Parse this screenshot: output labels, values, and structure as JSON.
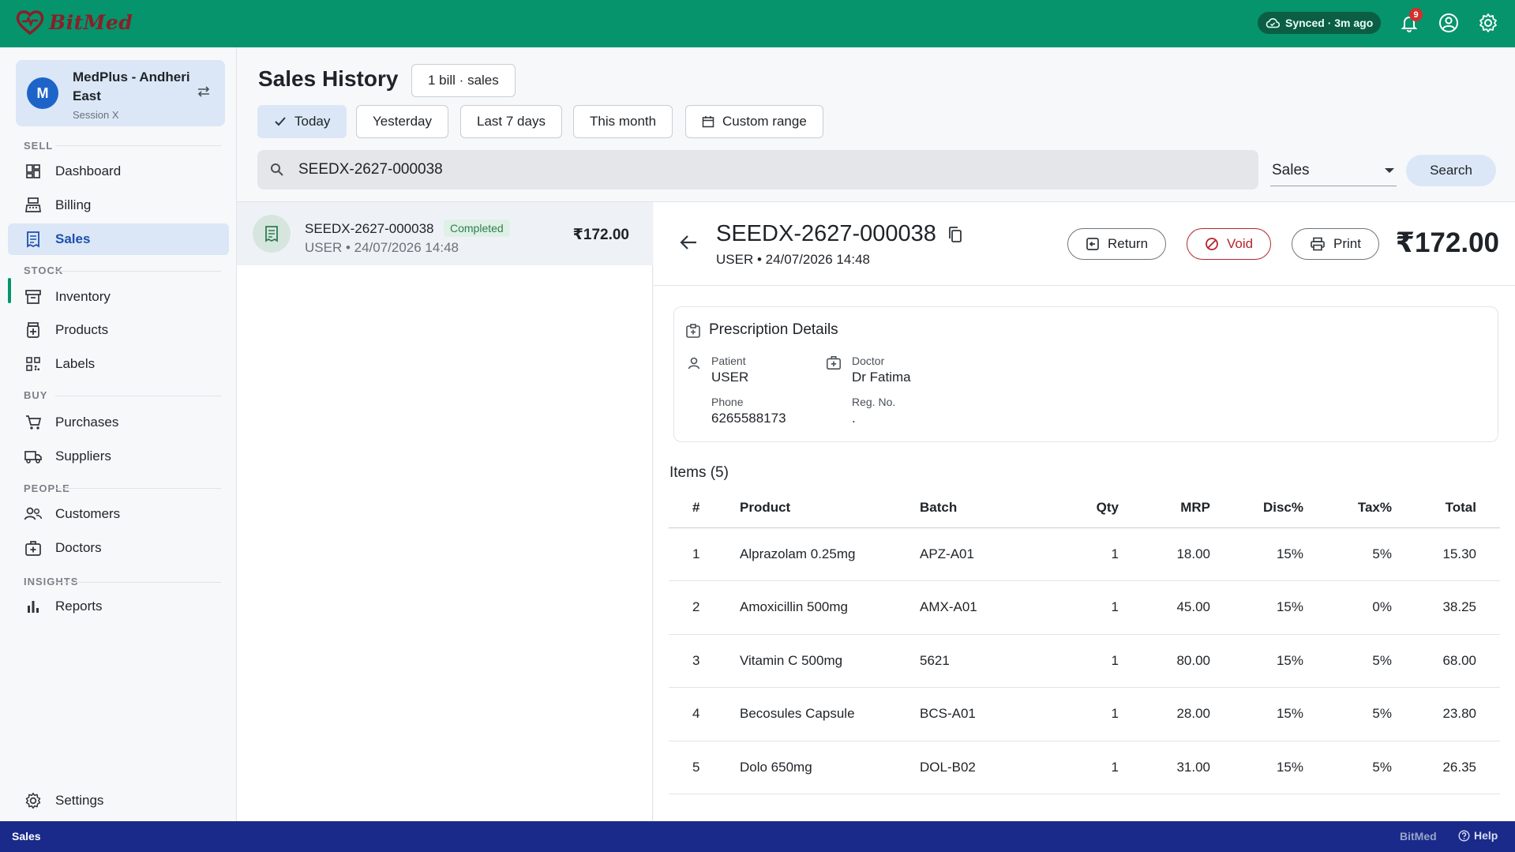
{
  "app": {
    "brand": "BitMed",
    "sync_status": "Synced · 3m ago",
    "notification_count": "9",
    "colors": {
      "topbar": "#05946c",
      "statusbar": "#1a2a8a",
      "accent": "#1d4fb0",
      "void": "#b3262e"
    }
  },
  "store": {
    "avatar_letter": "M",
    "name": "MedPlus - Andheri East",
    "session": "Session X"
  },
  "sidebar": {
    "sections": {
      "sell": "SELL",
      "stock": "STOCK",
      "buy": "BUY",
      "people": "PEOPLE",
      "insights": "INSIGHTS"
    },
    "items": {
      "dashboard": "Dashboard",
      "billing": "Billing",
      "sales": "Sales",
      "inventory": "Inventory",
      "products": "Products",
      "labels": "Labels",
      "purchases": "Purchases",
      "suppliers": "Suppliers",
      "customers": "Customers",
      "doctors": "Doctors",
      "reports": "Reports",
      "settings": "Settings"
    }
  },
  "header": {
    "title": "Sales History",
    "count_chip": "1 bill · sales",
    "filters": {
      "today": "Today",
      "yesterday": "Yesterday",
      "last7": "Last 7 days",
      "month": "This month",
      "custom": "Custom range"
    },
    "search_value": "SEEDX-2627-000038",
    "search_type": "Sales",
    "search_button": "Search"
  },
  "list": {
    "rows": [
      {
        "id": "SEEDX-2627-000038",
        "status": "Completed",
        "sub": "USER • 24/07/2026 14:48",
        "amount": "₹172.00"
      }
    ]
  },
  "detail": {
    "bill_id": "SEEDX-2627-000038",
    "sub": "USER • 24/07/2026 14:48",
    "actions": {
      "return": "Return",
      "void": "Void",
      "print": "Print"
    },
    "total": "₹172.00",
    "prescription": {
      "title": "Prescription Details",
      "patient_label": "Patient",
      "patient": "USER",
      "phone_label": "Phone",
      "phone": "6265588173",
      "doctor_label": "Doctor",
      "doctor": "Dr Fatima",
      "reg_label": "Reg. No.",
      "reg": "."
    },
    "items_title": "Items (5)",
    "columns": {
      "idx": "#",
      "product": "Product",
      "batch": "Batch",
      "qty": "Qty",
      "mrp": "MRP",
      "disc": "Disc%",
      "tax": "Tax%",
      "total": "Total"
    },
    "items": [
      {
        "idx": "1",
        "product": "Alprazolam 0.25mg",
        "batch": "APZ-A01",
        "qty": "1",
        "mrp": "18.00",
        "disc": "15%",
        "tax": "5%",
        "total": "15.30"
      },
      {
        "idx": "2",
        "product": "Amoxicillin 500mg",
        "batch": "AMX-A01",
        "qty": "1",
        "mrp": "45.00",
        "disc": "15%",
        "tax": "0%",
        "total": "38.25"
      },
      {
        "idx": "3",
        "product": "Vitamin C 500mg",
        "batch": "5621",
        "qty": "1",
        "mrp": "80.00",
        "disc": "15%",
        "tax": "5%",
        "total": "68.00"
      },
      {
        "idx": "4",
        "product": "Becosules Capsule",
        "batch": "BCS-A01",
        "qty": "1",
        "mrp": "28.00",
        "disc": "15%",
        "tax": "5%",
        "total": "23.80"
      },
      {
        "idx": "5",
        "product": "Dolo 650mg",
        "batch": "DOL-B02",
        "qty": "1",
        "mrp": "31.00",
        "disc": "15%",
        "tax": "5%",
        "total": "26.35"
      }
    ]
  },
  "statusbar": {
    "left": "Sales",
    "brand": "BitMed",
    "help": "Help"
  }
}
